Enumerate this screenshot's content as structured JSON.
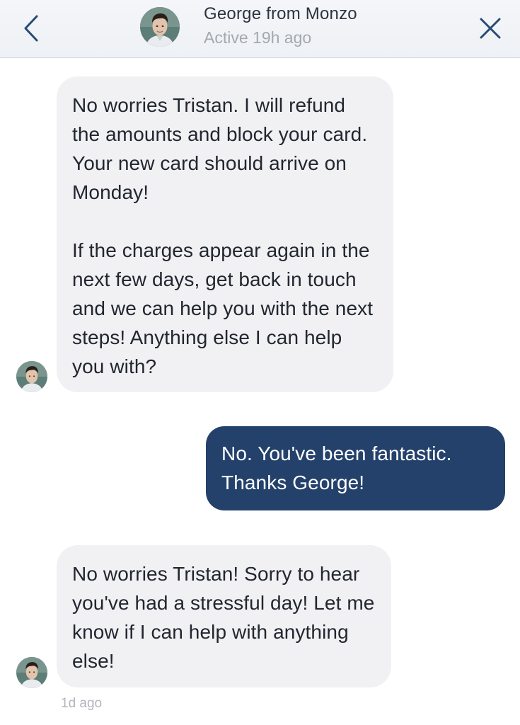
{
  "header": {
    "title": "George from Monzo",
    "status": "Active 19h ago",
    "back_icon": "chevron-left-icon",
    "close_icon": "close-icon",
    "accent_color": "#2a4a73"
  },
  "messages": [
    {
      "sender": "agent",
      "paragraphs": [
        "No worries Tristan. I will refund the amounts and block your card. Your new card should arrive on Monday!",
        "If the charges appear again in the next few days, get back in touch and we can help you with the next steps! Anything else I can help you with?"
      ]
    },
    {
      "sender": "user",
      "paragraphs": [
        "No. You've been fantastic. Thanks George!"
      ]
    },
    {
      "sender": "agent",
      "paragraphs": [
        "No worries Tristan! Sorry to hear you've had a stressful day! Let me know if I can help with anything else!"
      ],
      "timestamp": "1d ago"
    }
  ],
  "colors": {
    "incoming_bubble": "#f1f1f3",
    "outgoing_bubble": "#23416b",
    "header_bg": "#eef1f5"
  }
}
